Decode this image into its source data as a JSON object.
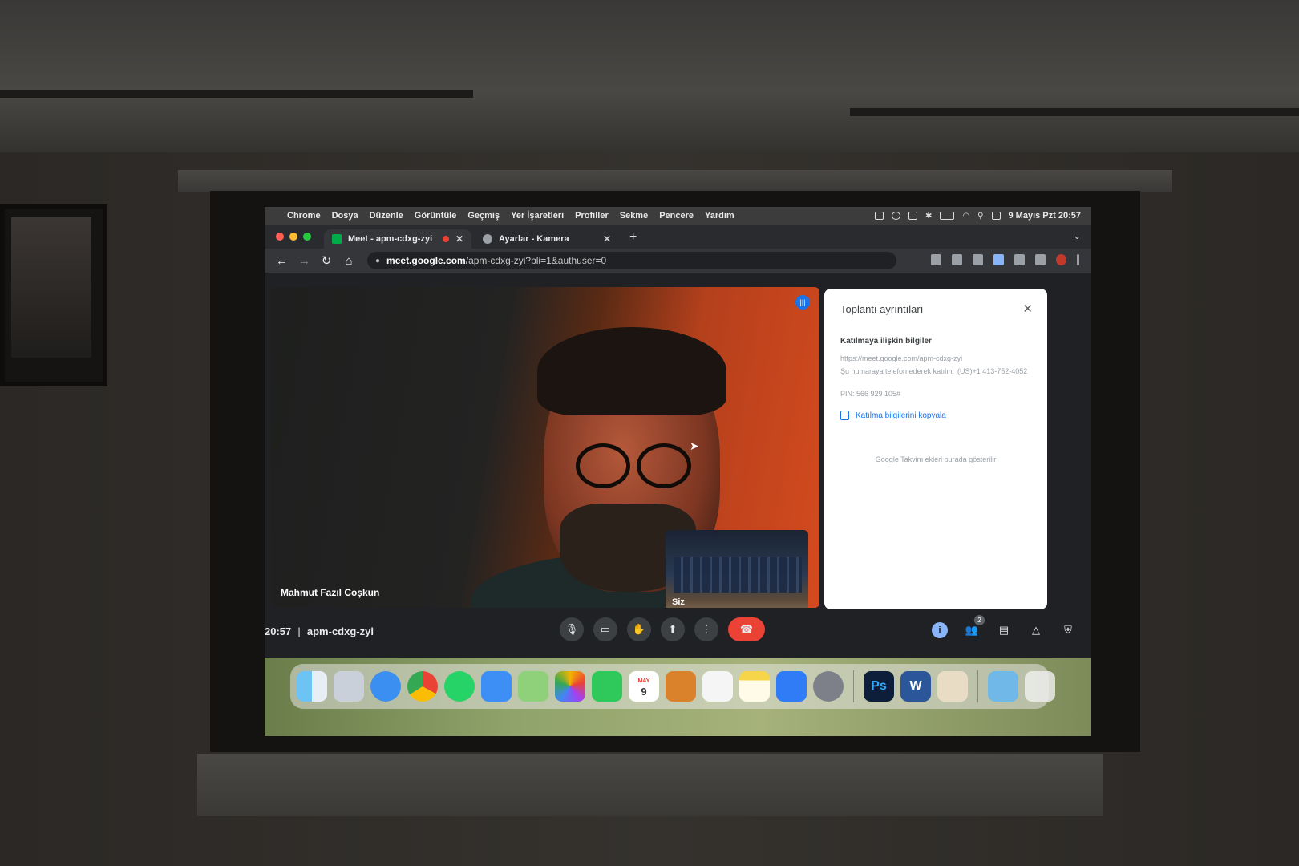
{
  "menubar": {
    "app": "Chrome",
    "items": [
      "Dosya",
      "Düzenle",
      "Görüntüle",
      "Geçmiş",
      "Yer İşaretleri",
      "Profiller",
      "Sekme",
      "Pencere",
      "Yardım"
    ],
    "clock": "9 Mayıs Pzt 20:57"
  },
  "tabs": [
    {
      "label": "Meet - apm-cdxg-zyi",
      "active": true
    },
    {
      "label": "Ayarlar - Kamera",
      "active": false
    }
  ],
  "address": {
    "host": "meet.google.com",
    "path": "/apm-cdxg-zyi?pli=1&authuser=0"
  },
  "meeting": {
    "speaker_name": "Mahmut Fazıl Coşkun",
    "self_label": "Siz",
    "time": "20:57",
    "code": "apm-cdxg-zyi",
    "participant_count": "2"
  },
  "panel": {
    "title": "Toplantı ayrıntıları",
    "subtitle": "Katılmaya ilişkin bilgiler",
    "link": "https://meet.google.com/apm-cdxg-zyi",
    "phone_text": "Şu numaraya telefon ederek katılın:",
    "phone_number": "(US)+1 413-752-4052",
    "pin": "PIN: 566 929 105#",
    "copy_label": "Katılma bilgilerini kopyala",
    "calendar_note": "Google Takvim ekleri burada gösterilir"
  },
  "dock": {
    "apps": [
      "finder-icon",
      "launchpad-icon",
      "safari-icon",
      "chrome-icon",
      "whatsapp-icon",
      "mail-icon",
      "maps-icon",
      "photos-icon",
      "facetime-icon",
      "calendar-icon",
      "contacts-icon",
      "reminders-icon",
      "notes-icon",
      "app-store-icon",
      "system-preferences-icon",
      "photoshop-icon",
      "word-icon",
      "preview-icon",
      "downloads-folder-icon",
      "trash-icon"
    ],
    "calendar_month": "MAY",
    "calendar_day": "9",
    "photoshop_label": "Ps",
    "word_label": "W"
  },
  "colors": {
    "end_call": "#ea4335",
    "accent": "#1a73e8",
    "speaking": "#1a73e8"
  }
}
